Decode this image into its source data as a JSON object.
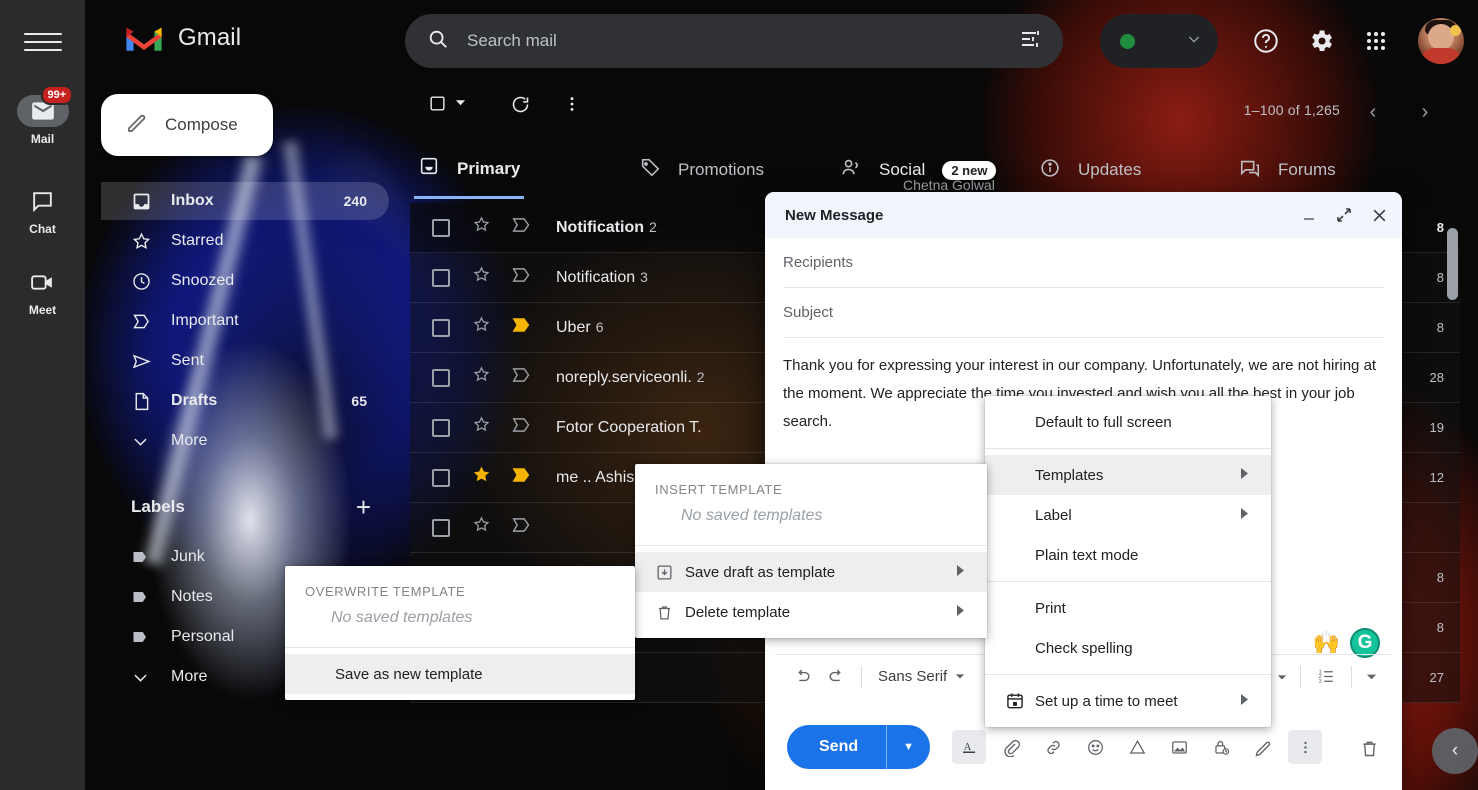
{
  "brand": {
    "name": "Gmail",
    "accent": "#1a73e8",
    "badge_red": "#c5221f",
    "tab_blue": "#8ab4f8"
  },
  "rail": {
    "menu_icon": "hamburger-icon",
    "items": [
      {
        "label": "Mail",
        "icon": "mail-icon",
        "badge": "99+",
        "active": true
      },
      {
        "label": "Chat",
        "icon": "chat-icon",
        "badge": "",
        "active": false
      },
      {
        "label": "Meet",
        "icon": "meet-icon",
        "badge": "",
        "active": false
      }
    ]
  },
  "header": {
    "logo_label": "Gmail",
    "search": {
      "placeholder": "Search mail",
      "value": "",
      "icon": "search-icon",
      "options_icon": "search-options-icon"
    },
    "status": {
      "state_color": "#1e8e3e",
      "caret_icon": "chevron-down-icon"
    },
    "help_icon": "help-icon",
    "settings_icon": "gear-icon",
    "apps_icon": "apps-grid-icon",
    "avatar_icon": "avatar"
  },
  "sidebar": {
    "compose": {
      "label": "Compose",
      "icon": "pencil-icon"
    },
    "nav": [
      {
        "label": "Inbox",
        "icon": "inbox-icon",
        "count": "240",
        "active": true
      },
      {
        "label": "Starred",
        "icon": "star-icon",
        "count": "",
        "active": false
      },
      {
        "label": "Snoozed",
        "icon": "clock-icon",
        "count": "",
        "active": false
      },
      {
        "label": "Important",
        "icon": "important-icon",
        "count": "",
        "active": false
      },
      {
        "label": "Sent",
        "icon": "send-icon",
        "count": "",
        "active": false
      },
      {
        "label": "Drafts",
        "icon": "draft-icon",
        "count": "65",
        "active": false
      },
      {
        "label": "More",
        "icon": "chevron-down-icon",
        "count": "",
        "active": false
      }
    ],
    "labels_header": {
      "title": "Labels",
      "add_icon": "plus-icon"
    },
    "labels": [
      {
        "label": "Junk",
        "icon": "label-icon"
      },
      {
        "label": "Notes",
        "icon": "label-icon"
      },
      {
        "label": "Personal",
        "icon": "label-icon"
      },
      {
        "label": "More",
        "icon": "chevron-down-icon"
      }
    ]
  },
  "list_toolbar": {
    "select_icon": "select-all-checkbox",
    "select_caret": "chevron-down-icon",
    "refresh_icon": "refresh-icon",
    "more_icon": "more-vertical-icon",
    "page_range": "1–100 of 1,265",
    "prev_icon": "chevron-left-icon",
    "next_icon": "chevron-right-icon"
  },
  "tabs": [
    {
      "label": "Primary",
      "icon": "inbox-tab-icon",
      "badge": "",
      "sub": "",
      "active": true
    },
    {
      "label": "Promotions",
      "icon": "tag-icon",
      "badge": "",
      "sub": "",
      "active": false
    },
    {
      "label": "Social",
      "icon": "people-icon",
      "badge": "2 new",
      "sub": "Chetna Golwal",
      "active": false
    },
    {
      "label": "Updates",
      "icon": "info-icon",
      "badge": "",
      "sub": "",
      "active": false
    },
    {
      "label": "Forums",
      "icon": "forum-icon",
      "badge": "",
      "sub": "",
      "active": false
    }
  ],
  "messages": [
    {
      "sender": "Notification",
      "count": "2",
      "date": "8",
      "starred": false,
      "important": false,
      "unread": true
    },
    {
      "sender": "Notification",
      "count": "3",
      "date": "8",
      "starred": false,
      "important": false,
      "unread": false
    },
    {
      "sender": "Uber",
      "count": "6",
      "date": "8",
      "starred": false,
      "important": true,
      "unread": false
    },
    {
      "sender": "noreply.serviceonli.",
      "count": "2",
      "date": "28",
      "starred": false,
      "important": false,
      "unread": false
    },
    {
      "sender": "Fotor Cooperation T.",
      "count": "",
      "date": "19",
      "starred": false,
      "important": false,
      "unread": false
    },
    {
      "sender": "me .. Ashish,",
      "count": "",
      "date": "12",
      "starred": true,
      "important": true,
      "unread": false
    },
    {
      "sender": "",
      "count": "",
      "date": "",
      "starred": false,
      "important": false,
      "unread": false
    },
    {
      "sender": "",
      "count": "",
      "date": "8",
      "starred": false,
      "important": false,
      "unread": false
    },
    {
      "sender": "",
      "count": "",
      "date": "8",
      "starred": false,
      "important": false,
      "unread": false
    },
    {
      "sender": "",
      "count": "",
      "date": "27",
      "starred": false,
      "important": false,
      "unread": false
    }
  ],
  "compose": {
    "title": "New Message",
    "minimize_icon": "minimize-icon",
    "fullscreen_icon": "fullscreen-icon",
    "close_icon": "close-icon",
    "recipients_placeholder": "Recipients",
    "recipients_value": "",
    "subject_placeholder": "Subject",
    "subject_value": "",
    "body": "Thank you for expressing your interest in our company. Unfortunately, we are not hiring at the moment. We appreciate the time you invested and wish you all the best in your job search.",
    "format_bar": {
      "undo_icon": "undo-icon",
      "redo_icon": "redo-icon",
      "font_name": "Sans Serif",
      "font_caret": "chevron-down-icon",
      "align_icon": "align-icon",
      "align_caret": "chevron-down-icon",
      "list_icon": "numbered-list-icon",
      "more_caret": "chevron-down-icon"
    },
    "send": {
      "label": "Send",
      "caret_icon": "chevron-down-icon"
    },
    "send_bar_icons": [
      "format-text-icon",
      "attach-file-icon",
      "insert-link-icon",
      "insert-emoji-icon",
      "insert-drive-icon",
      "insert-photo-icon",
      "confidential-mode-icon",
      "insert-signature-icon",
      "more-options-icon"
    ],
    "trash_icon": "delete-draft-icon",
    "emoji_hands": "🙌",
    "grammarly_icon": "grammarly-icon"
  },
  "menu_more": {
    "items": [
      {
        "label": "Default to full screen",
        "icon": "",
        "arrow": false,
        "highlight": false,
        "sep_after": true
      },
      {
        "label": "Templates",
        "icon": "",
        "arrow": true,
        "highlight": true,
        "sep_after": false
      },
      {
        "label": "Label",
        "icon": "",
        "arrow": true,
        "highlight": false,
        "sep_after": false
      },
      {
        "label": "Plain text mode",
        "icon": "",
        "arrow": false,
        "highlight": false,
        "sep_after": true
      },
      {
        "label": "Print",
        "icon": "",
        "arrow": false,
        "highlight": false,
        "sep_after": false
      },
      {
        "label": "Check spelling",
        "icon": "",
        "arrow": false,
        "highlight": false,
        "sep_after": true
      },
      {
        "label": "Set up a time to meet",
        "icon": "calendar-icon",
        "arrow": true,
        "highlight": false,
        "sep_after": false
      }
    ]
  },
  "menu_templates": {
    "header": "Insert template",
    "empty": "No saved templates",
    "items": [
      {
        "label": "Save draft as template",
        "icon": "save-template-icon",
        "arrow": true,
        "highlight": true
      },
      {
        "label": "Delete template",
        "icon": "delete-template-icon",
        "arrow": true,
        "highlight": false
      }
    ]
  },
  "menu_overwrite": {
    "header": "Overwrite template",
    "empty": "No saved templates",
    "items": [
      {
        "label": "Save as new template",
        "icon": "",
        "arrow": false,
        "highlight": true
      }
    ]
  },
  "right_edge": {
    "collapse_icon": "chevron-left-icon",
    "scrollbar": "list-scrollbar"
  }
}
